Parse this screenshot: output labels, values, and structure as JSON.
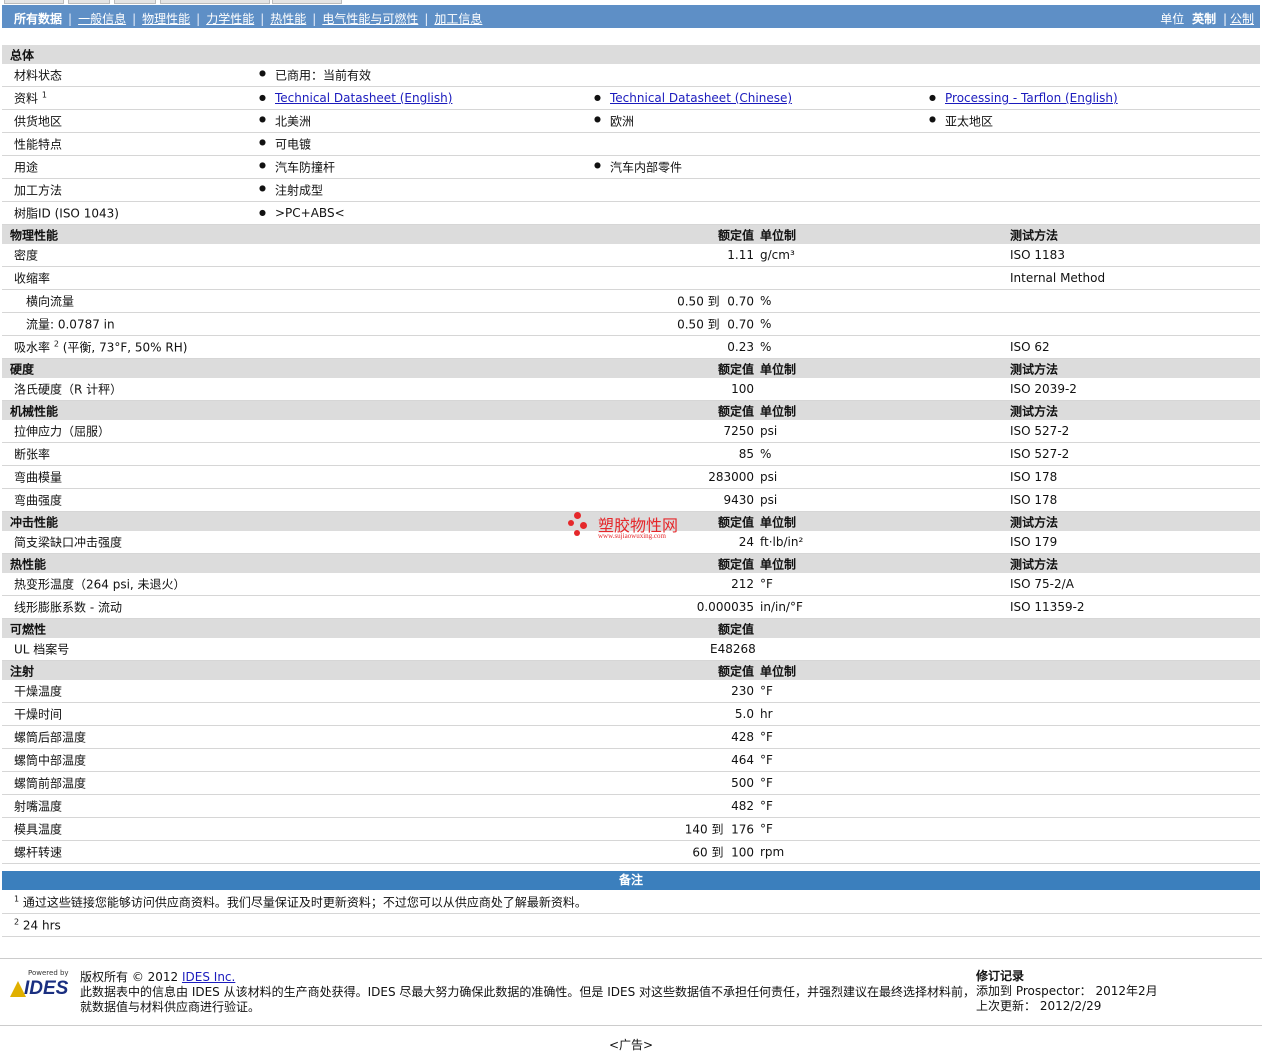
{
  "nav": {
    "items": [
      "所有数据",
      "一般信息",
      "物理性能",
      "力学性能",
      "热性能",
      "电气性能与可燃性",
      "加工信息"
    ],
    "units_label": "单位",
    "unit_selected": "英制",
    "unit_other": "公制"
  },
  "general": {
    "title": "总体",
    "rows": [
      {
        "label": "材料状态",
        "items": [
          "已商用：当前有效"
        ]
      },
      {
        "label": "资料",
        "sup": "1",
        "items": [
          "Technical Datasheet (English)",
          "Technical Datasheet (Chinese)",
          "Processing - Tarflon (English)"
        ],
        "links": true
      },
      {
        "label": "供货地区",
        "items": [
          "北美洲",
          "欧洲",
          "亚太地区"
        ]
      },
      {
        "label": "性能特点",
        "items": [
          "可电镀"
        ]
      },
      {
        "label": "用途",
        "items": [
          "汽车防撞杆",
          "汽车内部零件"
        ]
      },
      {
        "label": "加工方法",
        "items": [
          "注射成型"
        ]
      },
      {
        "label": "树脂ID (ISO 1043)",
        "items": [
          ">PC+ABS<"
        ]
      }
    ]
  },
  "headers": {
    "value": "额定值",
    "unit": "单位制",
    "method": "测试方法"
  },
  "physical": {
    "title": "物理性能",
    "rows": [
      {
        "label": "密度",
        "value": "1.11",
        "unit": "g/cm³",
        "method": "ISO 1183"
      },
      {
        "label": "收缩率",
        "value": "",
        "unit": "",
        "method": "Internal Method"
      },
      {
        "label": "横向流量",
        "value": "0.50 到  0.70",
        "unit": "%",
        "method": ""
      },
      {
        "label": "流量: 0.0787 in",
        "value": "0.50 到  0.70",
        "unit": "%",
        "method": ""
      },
      {
        "label": "吸水率",
        "sup": "2",
        "label_suffix": " (平衡, 73°F, 50% RH)",
        "value": "0.23",
        "unit": "%",
        "method": "ISO 62"
      }
    ]
  },
  "hardness": {
    "title": "硬度",
    "rows": [
      {
        "label": "洛氏硬度（R 计秤）",
        "value": "100",
        "unit": "",
        "method": "ISO 2039-2"
      }
    ]
  },
  "mechanical": {
    "title": "机械性能",
    "rows": [
      {
        "label": "拉伸应力（屈服）",
        "value": "7250",
        "unit": "psi",
        "method": "ISO 527-2"
      },
      {
        "label": "断张率",
        "value": "85",
        "unit": "%",
        "method": "ISO 527-2"
      },
      {
        "label": "弯曲模量",
        "value": "283000",
        "unit": "psi",
        "method": "ISO 178"
      },
      {
        "label": "弯曲强度",
        "value": "9430",
        "unit": "psi",
        "method": "ISO 178"
      }
    ]
  },
  "impact": {
    "title": "冲击性能",
    "rows": [
      {
        "label": "简支梁缺口冲击强度",
        "value": "24",
        "unit": "ft·lb/in²",
        "method": "ISO 179"
      }
    ]
  },
  "thermal": {
    "title": "热性能",
    "rows": [
      {
        "label": "热变形温度（264 psi, 未退火）",
        "value": "212",
        "unit": "°F",
        "method": "ISO 75-2/A"
      },
      {
        "label": "线形膨胀系数  - 流动",
        "value": "0.000035",
        "unit": "in/in/°F",
        "method": "ISO 11359-2"
      }
    ]
  },
  "flammability": {
    "title": "可燃性",
    "rows": [
      {
        "label": "UL 档案号",
        "value": "E48268"
      }
    ]
  },
  "injection": {
    "title": "注射",
    "rows": [
      {
        "label": "干燥温度",
        "value": "230",
        "unit": "°F"
      },
      {
        "label": "干燥时间",
        "value": "5.0",
        "unit": "hr"
      },
      {
        "label": "螺筒后部温度",
        "value": "428",
        "unit": "°F"
      },
      {
        "label": "螺筒中部温度",
        "value": "464",
        "unit": "°F"
      },
      {
        "label": "螺筒前部温度",
        "value": "500",
        "unit": "°F"
      },
      {
        "label": "射嘴温度",
        "value": "482",
        "unit": "°F"
      },
      {
        "label": "模具温度",
        "value": "140 到  176",
        "unit": "°F"
      },
      {
        "label": "螺杆转速",
        "value": "60 到  100",
        "unit": "rpm"
      }
    ]
  },
  "notes": {
    "title": "备注",
    "items": [
      {
        "num": "1",
        "text": "通过这些链接您能够访问供应商资料。我们尽量保证及时更新资料；不过您可以从供应商处了解最新资料。"
      },
      {
        "num": "2",
        "text": "24 hrs"
      }
    ]
  },
  "footer": {
    "logo_powered": "Powered by",
    "logo_name": "IDES",
    "copyright_prefix": "版权所有  © 2012 ",
    "copyright_link": "IDES Inc.",
    "disclaimer_1": "此数据表中的信息由  IDES 从该材料的生产商处获得。IDES 尽最大努力确保此数据的准确性。但是  IDES 对这些数据值不承担任何责任，并强烈建议在最终选择材料前，",
    "disclaimer_2": "就数据值与材料供应商进行验证。",
    "rev_title": "修订记录",
    "rev_added": "添加到  Prospector：  2012年2月",
    "rev_updated": "上次更新：  2012/2/29"
  },
  "ad": "<广告>",
  "watermark": {
    "title": "塑胶物性网",
    "url": "www.sujiaowuxing.com"
  }
}
